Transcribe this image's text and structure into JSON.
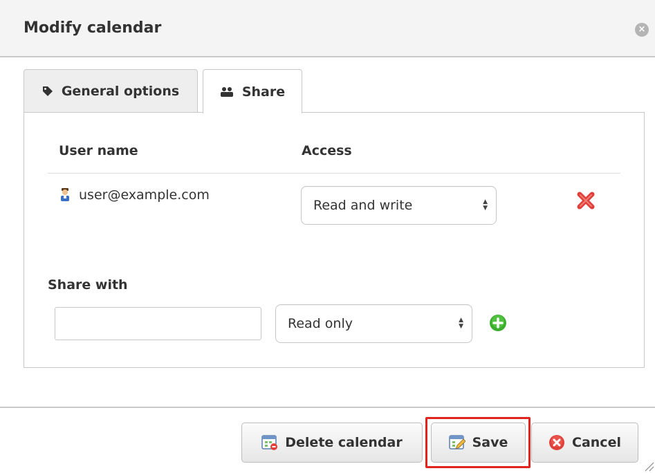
{
  "dialog": {
    "title": "Modify calendar",
    "close_icon": "close-circle-icon"
  },
  "tabs": [
    {
      "label": "General options",
      "icon": "tag-icon",
      "active": false
    },
    {
      "label": "Share",
      "icon": "users-icon",
      "active": true
    }
  ],
  "share_table": {
    "headers": {
      "user": "User name",
      "access": "Access"
    },
    "rows": [
      {
        "user": "user@example.com",
        "access": "Read and write",
        "user_icon": "user-icon",
        "remove_icon": "remove-x-icon"
      }
    ]
  },
  "share_with": {
    "label": "Share with",
    "input_value": "",
    "access_value": "Read only",
    "add_icon": "add-circle-icon"
  },
  "footer": {
    "delete_label": "Delete calendar",
    "save_label": "Save",
    "cancel_label": "Cancel",
    "highlighted": "Save",
    "highlight_color": "#e2241c"
  },
  "colors": {
    "remove": "#e0403a",
    "add": "#3cae2e",
    "cancel": "#e0403a"
  }
}
